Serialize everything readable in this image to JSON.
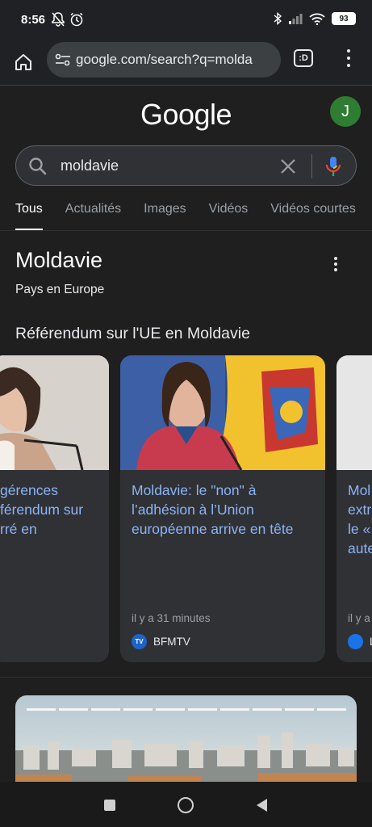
{
  "status": {
    "time": "8:56",
    "battery": "93"
  },
  "browser": {
    "url": "google.com/search?q=molda",
    "tab_switcher_label": ":D"
  },
  "header": {
    "logo": "Google",
    "avatar_initial": "J"
  },
  "search": {
    "query": "moldavie"
  },
  "tabs": [
    {
      "label": "Tous",
      "active": true
    },
    {
      "label": "Actualités"
    },
    {
      "label": "Images"
    },
    {
      "label": "Vidéos"
    },
    {
      "label": "Vidéos courtes"
    }
  ],
  "knowledge": {
    "title": "Moldavie",
    "subtitle": "Pays en Europe"
  },
  "news": {
    "section_title": "Référendum sur l'UE en Moldavie",
    "cards": [
      {
        "headline": "gérences\nférendum sur\nrré en",
        "time": "",
        "source": ""
      },
      {
        "headline": "Moldavie: le \"non\" à l’adhésion à l’Union européenne arrive en tête",
        "time": "il y a 31 minutes",
        "source": "BFMTV",
        "source_logo": "TV"
      },
      {
        "headline": "Mol\nextr\nle «\naute",
        "time": "il y a",
        "source": "L"
      }
    ]
  },
  "icons": {
    "home": "home-icon",
    "site_info": "tune-icon",
    "menu": "more-vert-icon",
    "search": "search-icon",
    "clear": "close-icon",
    "mic": "mic-icon"
  }
}
